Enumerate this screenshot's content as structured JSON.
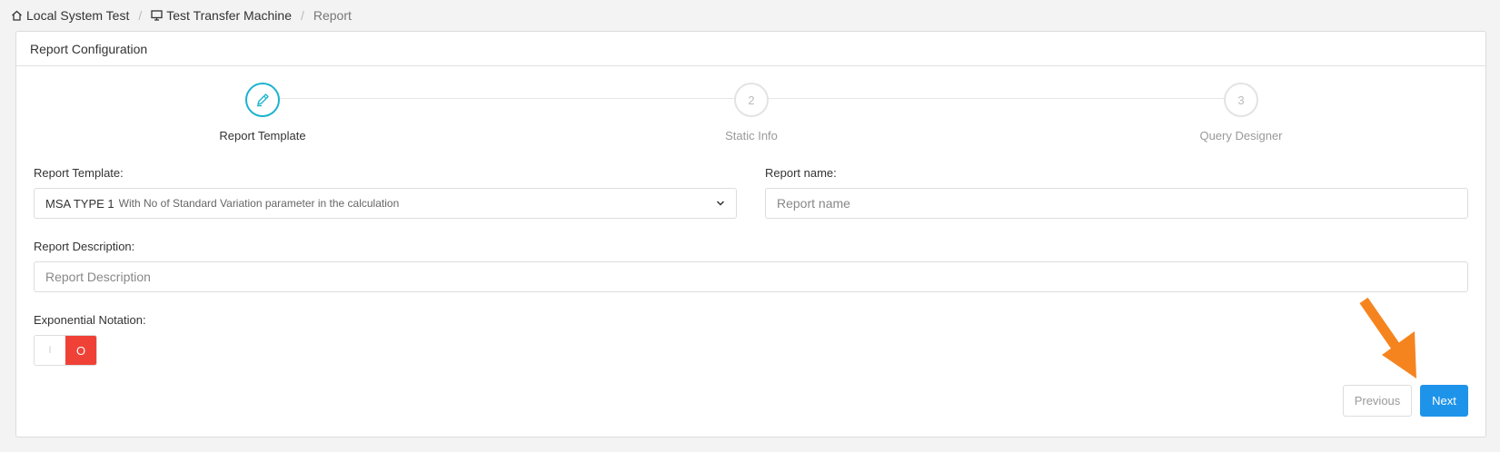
{
  "breadcrumb": {
    "items": [
      "Local System Test",
      "Test Transfer Machine"
    ],
    "current": "Report",
    "separator": "/"
  },
  "card": {
    "title": "Report Configuration"
  },
  "steps": [
    {
      "label": "Report Template",
      "number": "",
      "active": true,
      "icon": "pencil-icon"
    },
    {
      "label": "Static Info",
      "number": "2",
      "active": false
    },
    {
      "label": "Query Designer",
      "number": "3",
      "active": false
    }
  ],
  "form": {
    "template_label": "Report Template:",
    "template_value": "MSA TYPE 1",
    "template_description": "With No of Standard Variation parameter in the calculation",
    "name_label": "Report name:",
    "name_placeholder": "Report name",
    "description_label": "Report Description:",
    "description_placeholder": "Report Description",
    "exponential_label": "Exponential Notation:",
    "toggle_on": "I",
    "toggle_off": "O"
  },
  "buttons": {
    "previous": "Previous",
    "next": "Next"
  },
  "colors": {
    "accent": "#1bb3cf",
    "primary": "#1e93ea",
    "toggle_off": "#ef4136",
    "annotation_arrow": "#f5841f"
  }
}
